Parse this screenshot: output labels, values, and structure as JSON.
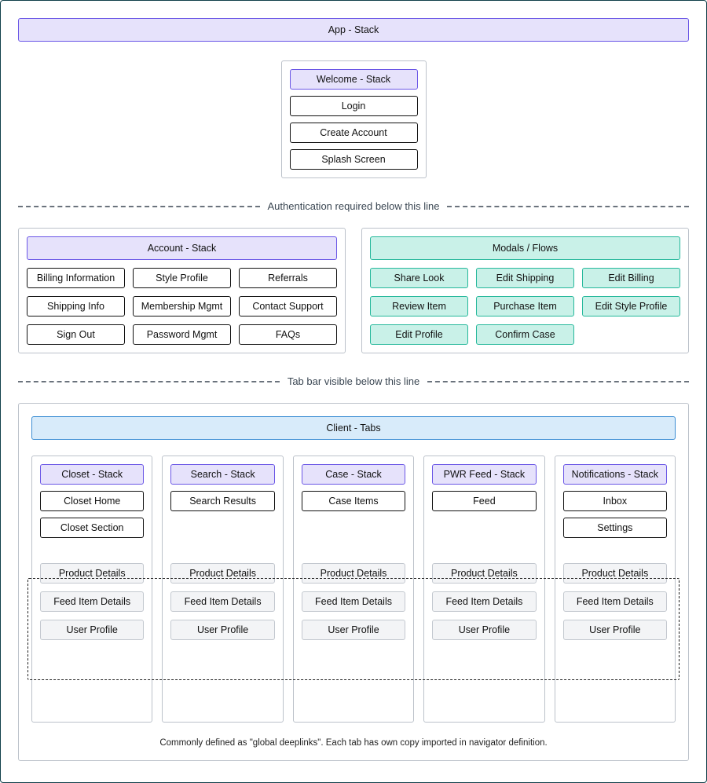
{
  "app_stack_label": "App - Stack",
  "welcome": {
    "title": "Welcome - Stack",
    "items": [
      "Login",
      "Create Account",
      "Splash Screen"
    ]
  },
  "divider": {
    "auth": "Authentication required below this line",
    "tabbar": "Tab bar visible below this line"
  },
  "account": {
    "title": "Account - Stack",
    "items": [
      "Billing Information",
      "Style Profile",
      "Referrals",
      "Shipping Info",
      "Membership Mgmt",
      "Contact Support",
      "Sign Out",
      "Password Mgmt",
      "FAQs"
    ]
  },
  "modals": {
    "title": "Modals / Flows",
    "items": [
      "Share Look",
      "Edit Shipping",
      "Edit Billing",
      "Review Item",
      "Purchase Item",
      "Edit Style Profile",
      "Edit Profile",
      "Confirm Case",
      ""
    ]
  },
  "client_tabs_label": "Client - Tabs",
  "tabs": [
    {
      "title": "Closet - Stack",
      "top_items": [
        "Closet Home",
        "Closet Section"
      ]
    },
    {
      "title": "Search - Stack",
      "top_items": [
        "Search Results"
      ]
    },
    {
      "title": "Case - Stack",
      "top_items": [
        "Case Items"
      ]
    },
    {
      "title": "PWR Feed - Stack",
      "top_items": [
        "Feed"
      ]
    },
    {
      "title": "Notifications - Stack",
      "top_items": [
        "Inbox",
        "Settings"
      ]
    }
  ],
  "deeplinks": [
    "Product Details",
    "Feed Item Details",
    "User Profile"
  ],
  "footnote": "Commonly defined as \"global deeplinks\". Each tab has own copy imported in navigator definition."
}
